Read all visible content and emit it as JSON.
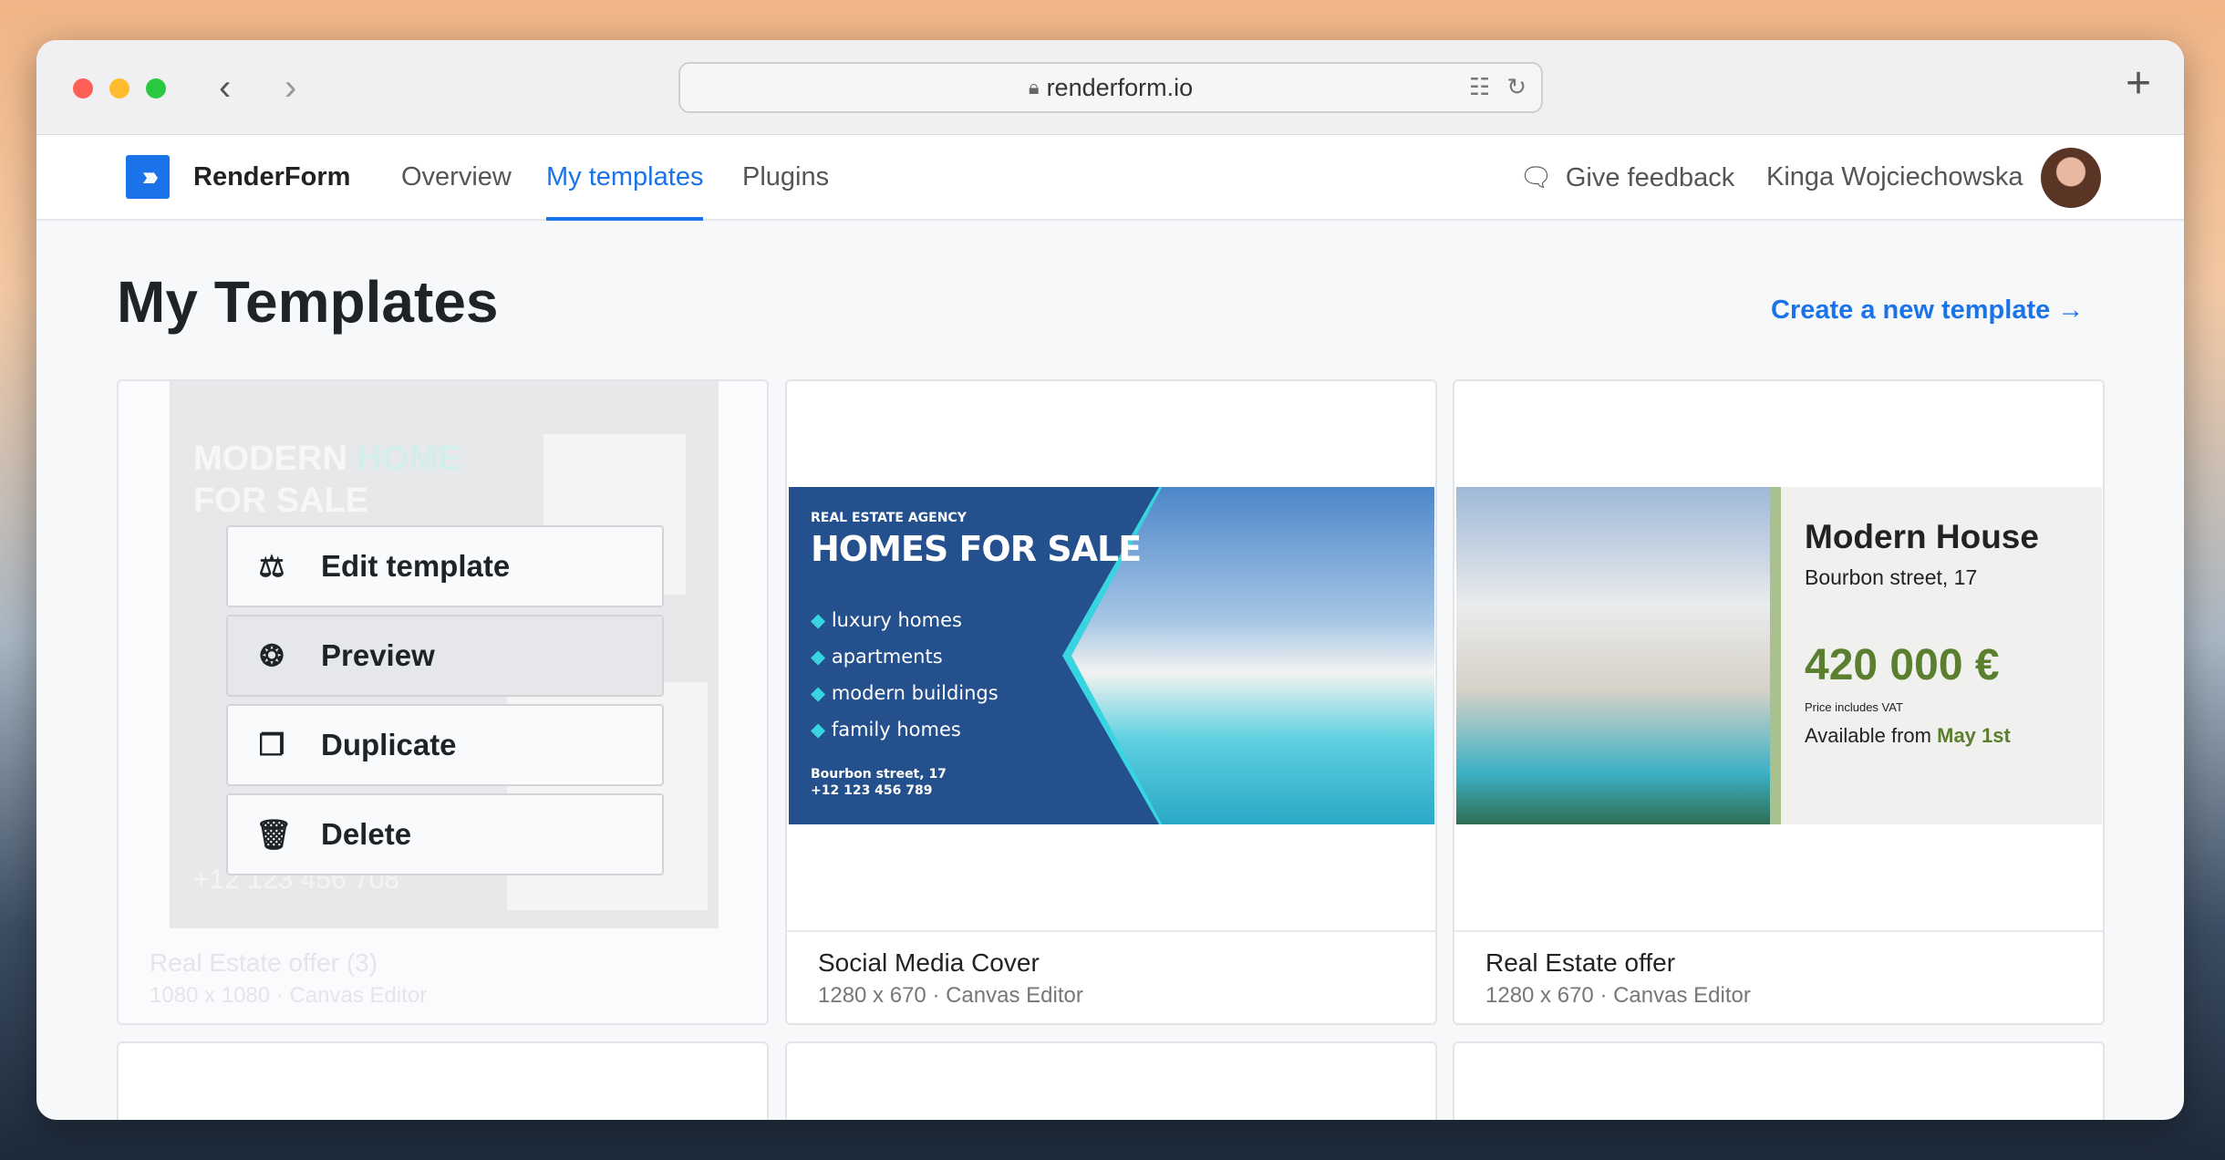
{
  "browser": {
    "url": "renderform.io"
  },
  "nav": {
    "brand": "RenderForm",
    "tabs": [
      "Overview",
      "My templates",
      "Plugins"
    ],
    "active_tab": "My templates",
    "feedback": "Give feedback",
    "user": "Kinga Wojciechowska"
  },
  "page": {
    "title": "My Templates",
    "create": "Create a new template →"
  },
  "menu": [
    "Edit template",
    "Preview",
    "Duplicate",
    "Delete"
  ],
  "templates": [
    {
      "name": "Real Estate offer (3)",
      "meta": "1080 x 1080  ·  Canvas Editor",
      "preview": {
        "line1": "MODERN",
        "line1b": "HOME",
        "line2": "FOR SALE",
        "phone": "+12 123 456 708"
      }
    },
    {
      "name": "Social Media Cover",
      "meta": "1280 x 670  ·  Canvas Editor",
      "preview": {
        "agency": "REAL ESTATE AGENCY",
        "headline": "HOMES FOR SALE",
        "bullets": [
          "luxury homes",
          "apartments",
          "modern buildings",
          "family homes"
        ],
        "address": "Bourbon street, 17",
        "phone": "+12 123 456 789"
      }
    },
    {
      "name": "Real Estate offer",
      "meta": "1280 x 670  ·  Canvas Editor",
      "preview": {
        "title": "Modern House",
        "address": "Bourbon street, 17",
        "price": "420 000 €",
        "vat": "Price includes VAT",
        "available": "Available from",
        "date": "May 1st"
      }
    }
  ],
  "colors": {
    "accent": "#1a73e8",
    "banner": "#24508e",
    "cyan": "#38d5e0",
    "green": "#5a7f2e"
  }
}
